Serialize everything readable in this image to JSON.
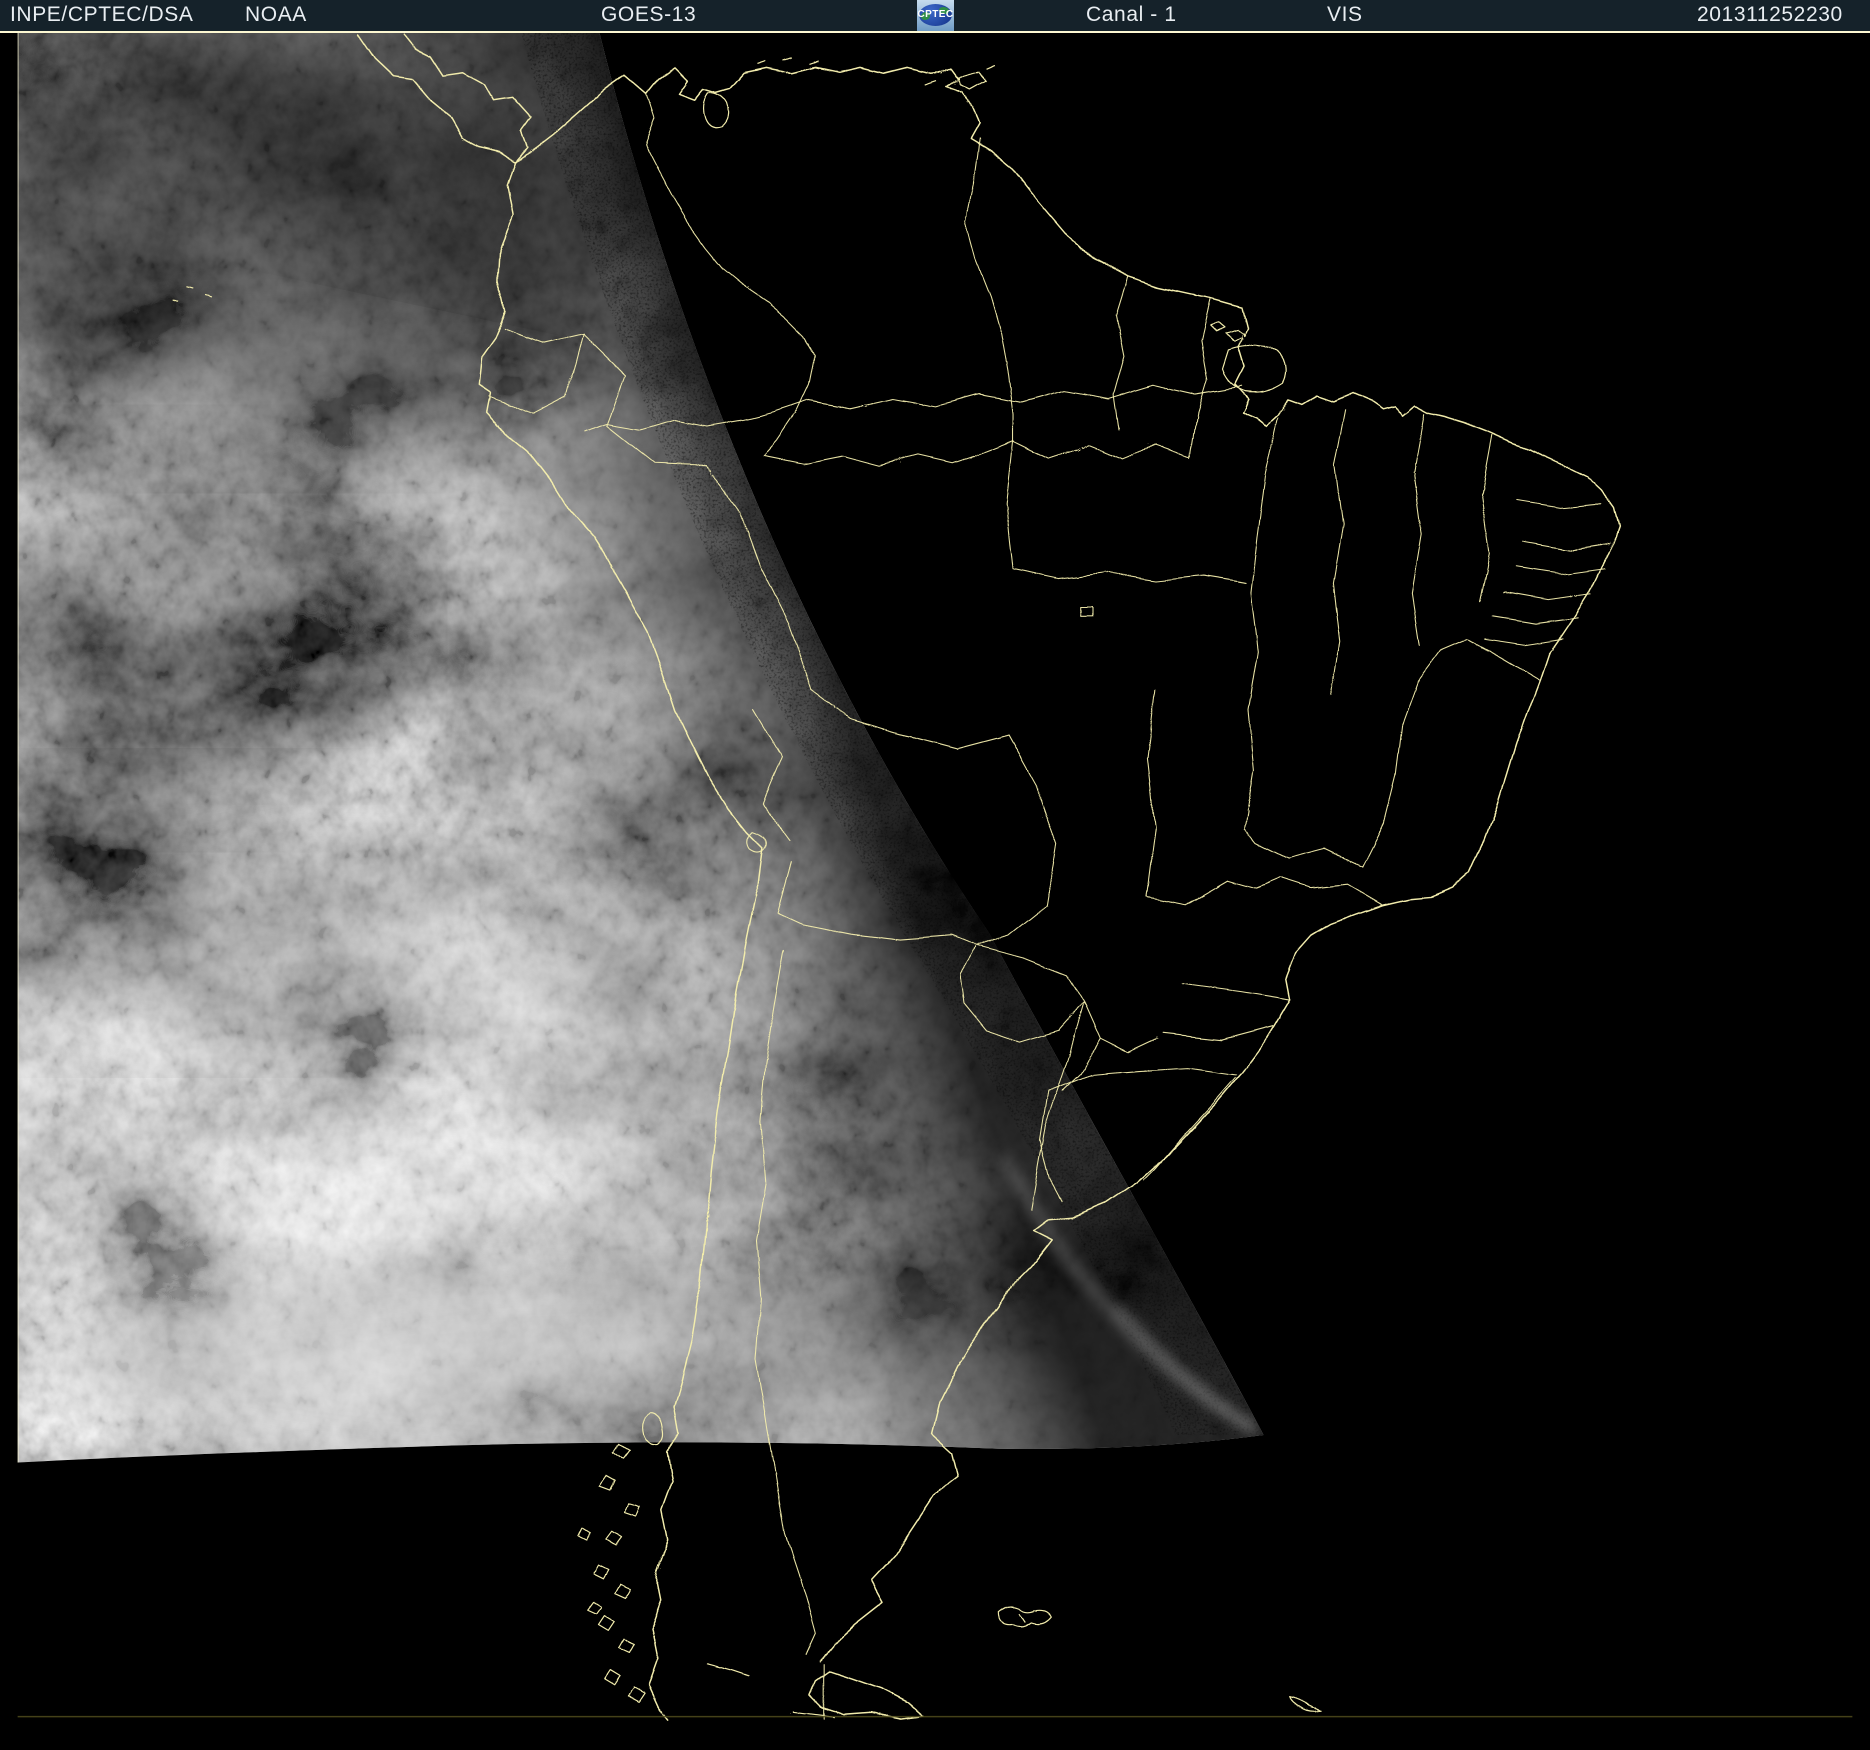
{
  "header": {
    "agency": "INPE/CPTEC/DSA",
    "noaa_label": "NOAA",
    "satellite": "GOES-13",
    "logo_text": "CPTEC",
    "channel_label": "Canal - 1",
    "band_label": "VIS",
    "timestamp": "201311252230"
  },
  "colors": {
    "header_bg": "#15222a",
    "header_fg": "#e9eef2",
    "divider": "#fdf8d2",
    "map_line": "#f2ecac",
    "night_bg": "#000000",
    "frame_bottom": "#56521e",
    "logo_bg_top": "#c6dcee",
    "logo_bg_bottom": "#6f9cc6",
    "logo_globe": "#1c3e97",
    "logo_land": "#2f9240",
    "logo_text_color": "#ffffff",
    "glint": "#eeeeee"
  }
}
